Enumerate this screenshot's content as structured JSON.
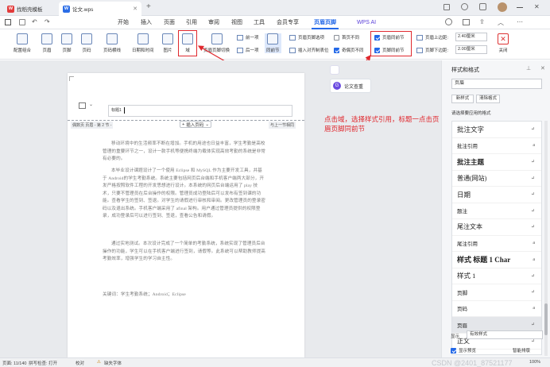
{
  "tabs": [
    {
      "label": "找稻壳模板"
    },
    {
      "label": "论文.wps"
    }
  ],
  "menus": [
    "开始",
    "插入",
    "页面",
    "引用",
    "审阅",
    "视图",
    "工具",
    "会员专享",
    "页眉页脚",
    "WPS AI"
  ],
  "ribbon": {
    "buttons": [
      "配置组合",
      "页眉",
      "页脚",
      "页码",
      "页码横线",
      "日期和时间",
      "图片",
      "域",
      "页眉页脚切换",
      "前一项",
      "后一项",
      "同前节",
      "插入对齐制表位",
      "关闭"
    ],
    "checks": {
      "header_options": "页眉页脚选项",
      "first_diff": "首页不同",
      "odd_even": "奇偶页不同",
      "header_same": "页眉同前节",
      "footer_same": "页脚同前节",
      "header_top": "页眉上边距:",
      "footer_bottom": "页脚下边距:"
    },
    "header_top_val": "2.40厘米",
    "footer_bottom_val": "2.00厘米"
  },
  "annotation": "点击域，选择样式引用，标题一点击页眉页脚同前节",
  "doc": {
    "header_field": "标题1",
    "header_label": "偶数页 页眉 - 第 2 节 -",
    "same_as_prev": "与上一节相同",
    "insert_page": "插入页码",
    "paragraphs": [
      "移动环境中的生活频率不断在增加。手机的用途也日益丰富，学生考勤是高校管理的重要环节之一，设计一款手机等便携终端为载体实现高效考勤的系统是非常有必要的。",
      "本毕业设计课题设计了一个使用 Eclipse 和 MySQL 作为主要开发工具，并基于 Android的学生考勤系统。系统主要包括网页后台端和手机客户端两大部分，开发严格按照软件工程的开发思想进行设计。本系统的网页后台端运用了 play 技术，只要不管理员在后台操作的权限。管理员成功登陆后可以发布有签到课的功能。查看学生的签到、签退。对学生的请假进行审核和审阅。更改管理员的登录密码以及退出系统。手机客户端采用了 afinal 架构。用户通过管理员提供的权限登录，成功登录后可以进行签到、签退，查看公告和请假。",
      "通过实地测试。本次设计完成了一个简单的考勤系统，系统实现了管理员后台操作的功能，学生可以在手机客户端进行签到，请假等。此系统可以帮助教师提高考勤效率，增强学生的学习自主性。"
    ],
    "keywords": "关键词：学生考勤系统；Android；Eclipse",
    "ai_button": "论文查重"
  },
  "side": {
    "title": "样式和格式",
    "current_style": "页眉",
    "new_style": "新样式",
    "clear_format": "清除格式",
    "apply_label": "请选择要应用的格式",
    "styles": [
      {
        "name": "批注文字",
        "mark": "↵",
        "size": 8.5,
        "bold": false
      },
      {
        "name": "批注引用",
        "mark": "a",
        "size": 6.5,
        "bold": false
      },
      {
        "name": "批注主题",
        "mark": "↵",
        "size": 8.5,
        "bold": true
      },
      {
        "name": "普通(网站)",
        "mark": "↵",
        "size": 8,
        "bold": false
      },
      {
        "name": "日期",
        "mark": "↵",
        "size": 8.5,
        "bold": false
      },
      {
        "name": "题注",
        "mark": "↵",
        "size": 6.5,
        "bold": false
      },
      {
        "name": "尾注文本",
        "mark": "↵",
        "size": 8,
        "bold": false
      },
      {
        "name": "尾注引用",
        "mark": "a",
        "size": 6.5,
        "bold": false
      },
      {
        "name": "样式 标题 1 Char",
        "mark": "a",
        "size": 9,
        "bold": true
      },
      {
        "name": "样式 1",
        "mark": "↵",
        "size": 8.5,
        "bold": false
      },
      {
        "name": "页脚",
        "mark": "↵",
        "size": 6.5,
        "bold": false
      },
      {
        "name": "页码",
        "mark": "a",
        "size": 6.5,
        "bold": false
      },
      {
        "name": "页眉",
        "mark": "↵",
        "size": 6.5,
        "bold": false
      },
      {
        "name": "正文",
        "mark": "↵",
        "size": 8,
        "bold": false
      }
    ],
    "show_label": "显示",
    "show_value": "有效样式",
    "preview_label": "显示预览",
    "intelligent": "智能排版"
  },
  "status": {
    "page": "页面: 11/140",
    "spell": "拼写检查: 打开",
    "proofread": "校对",
    "missing_font": "缺失字体",
    "zoom": "100%",
    "watermark": "CSDN @2401_87521177"
  },
  "colors": {
    "accent": "#2469e8",
    "red": "#e0282e"
  }
}
